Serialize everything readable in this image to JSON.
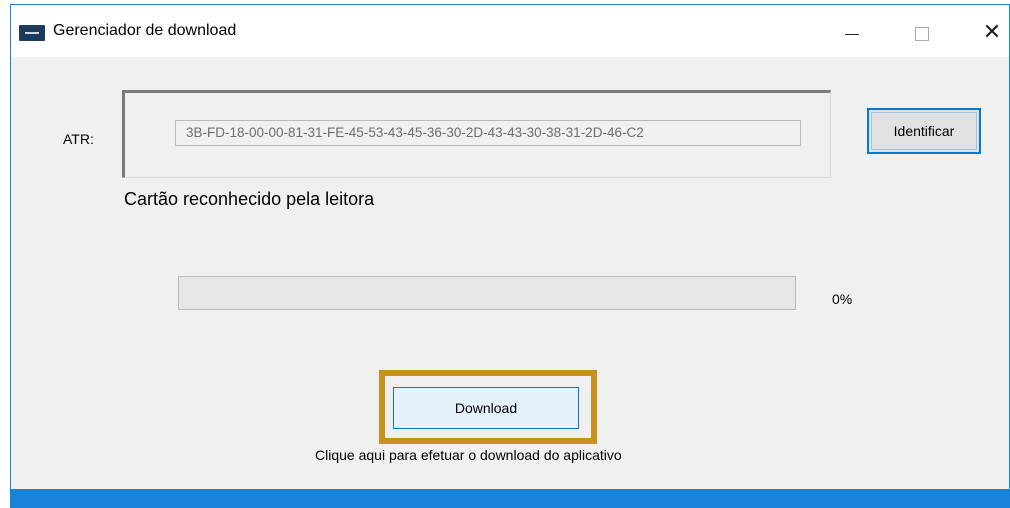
{
  "window": {
    "title": "Gerenciador de download"
  },
  "title_controls": {
    "minimize": "—",
    "maximize": "☐",
    "close": "✕"
  },
  "atr": {
    "label": "ATR:",
    "value": "3B-FD-18-00-00-81-31-FE-45-53-43-45-36-30-2D-43-43-30-38-31-2D-46-C2"
  },
  "identify_button": {
    "label": "Identificar"
  },
  "status": {
    "text": "Cartão reconhecido pela leitora"
  },
  "progress": {
    "value": 0,
    "percent_text": "0%"
  },
  "download_button": {
    "label": "Download"
  },
  "hint": {
    "text": "Clique aqui para efetuar o download do aplicativo"
  },
  "colors": {
    "accent": "#0078d7",
    "highlight": "#c8901d",
    "window_border": "#1883d7"
  }
}
